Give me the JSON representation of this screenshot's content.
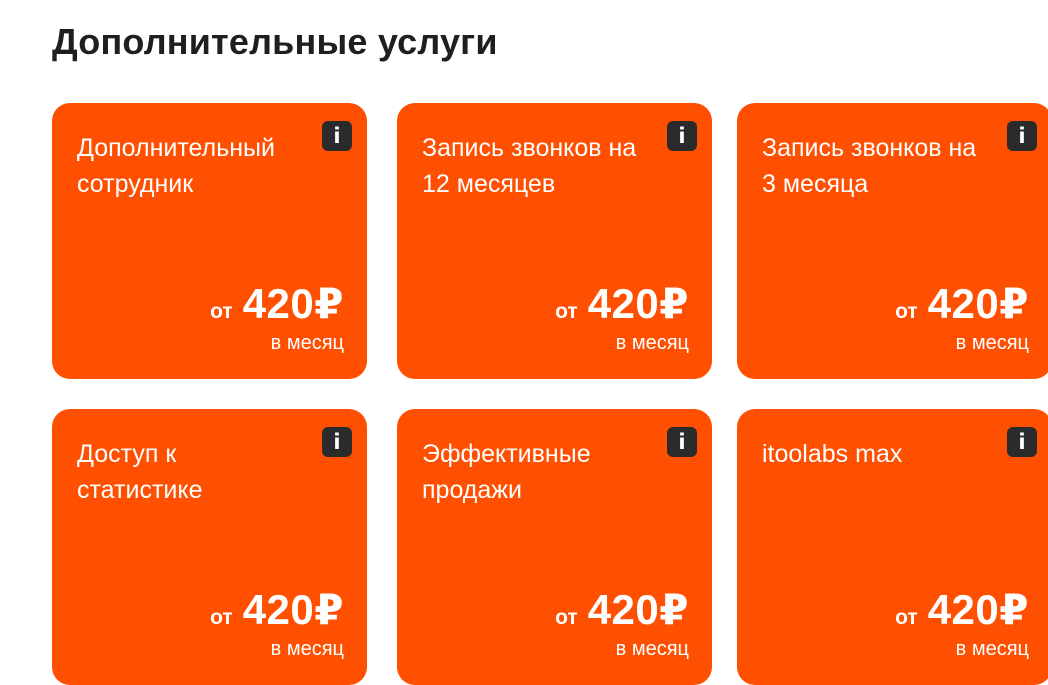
{
  "header": {
    "title": "Дополнительные услуги"
  },
  "colors": {
    "card_background": "#ff4f00",
    "info_button": "#2b2b2b",
    "text_on_card": "#ffffff",
    "title_text": "#1f1f1f"
  },
  "cards": [
    {
      "title": "Дополнительный сотрудник",
      "info_icon": "i",
      "price_prefix": "от",
      "price": "420₽",
      "period": "в месяц"
    },
    {
      "title": "Запись звонков на 12 месяцев",
      "info_icon": "i",
      "price_prefix": "от",
      "price": "420₽",
      "period": "в месяц"
    },
    {
      "title": "Запись звонков на 3 месяца",
      "info_icon": "i",
      "price_prefix": "от",
      "price": "420₽",
      "period": "в месяц"
    },
    {
      "title": "Доступ к статистике",
      "info_icon": "i",
      "price_prefix": "от",
      "price": "420₽",
      "period": "в месяц"
    },
    {
      "title": "Эффективные продажи",
      "info_icon": "i",
      "price_prefix": "от",
      "price": "420₽",
      "period": "в месяц"
    },
    {
      "title": "itoolabs max",
      "info_icon": "i",
      "price_prefix": "от",
      "price": "420₽",
      "period": "в месяц"
    }
  ]
}
